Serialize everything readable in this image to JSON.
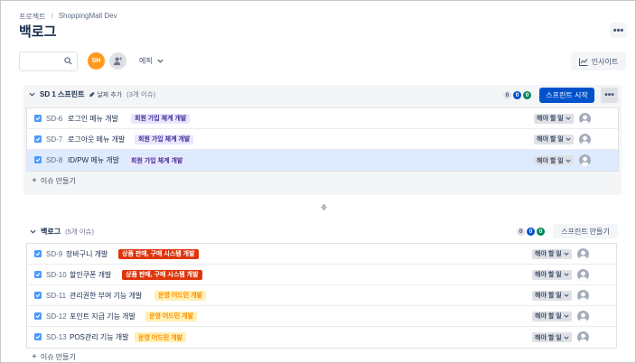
{
  "breadcrumb": {
    "root": "프로젝트",
    "separator": "/",
    "project": "ShoppingMall Dev"
  },
  "page": {
    "title": "백로그"
  },
  "toolbar": {
    "avatar_initials": "SH",
    "epic_filter_label": "에픽",
    "insight_label": "인사이트"
  },
  "sprint": {
    "name": "SD 1 스프린트",
    "add_date_label": "날짜 추가",
    "issue_count": "(3개 이슈)",
    "counts": [
      "0",
      "0",
      "0"
    ],
    "start_label": "스프린트 시작",
    "create_issue_label": "이슈 만들기",
    "issues": [
      {
        "key": "SD-6",
        "summary": "로그인 메뉴 개발",
        "epic": "회원 가입 체계 개발",
        "status": "해야 할 일"
      },
      {
        "key": "SD-7",
        "summary": "로그아웃 메뉴 개발",
        "epic": "회원 가입 체계 개발",
        "status": "해야 할 일"
      },
      {
        "key": "SD-8",
        "summary": "ID/PW 메뉴 개발",
        "epic": "회원 가입 체계 개발",
        "status": "해야 할 일"
      }
    ]
  },
  "backlog": {
    "name": "백로그",
    "issue_count": "(5개 이슈)",
    "counts": [
      "0",
      "0",
      "0"
    ],
    "create_sprint_label": "스프린트 만들기",
    "create_issue_label": "이슈 만들기",
    "issues": [
      {
        "key": "SD-9",
        "summary": "장바구니 개발",
        "epic": "상품 판매, 구매 시스템 개발",
        "status": "해야 할 일"
      },
      {
        "key": "SD-10",
        "summary": "할인쿠폰 개발",
        "epic": "상품 판매, 구매 시스템 개발",
        "status": "해야 할 일"
      },
      {
        "key": "SD-11",
        "summary": "관리권한 부여 기능 개발",
        "epic": "운영 어드민 개발",
        "status": "해야 할 일"
      },
      {
        "key": "SD-12",
        "summary": "포인트 지급 기능 개발",
        "epic": "운영 어드민 개발",
        "status": "해야 할 일"
      },
      {
        "key": "SD-13",
        "summary": "POS관리 기능 개발",
        "epic": "운영 어드민 개발",
        "status": "해야 할 일"
      }
    ]
  },
  "colors": {
    "primary": "#0052cc",
    "epic_purple": "#eae6ff",
    "epic_red": "#de350b",
    "epic_yellow": "#fff0b3",
    "avatar_orange": "#ff991f",
    "selected_row": "#deebff"
  }
}
